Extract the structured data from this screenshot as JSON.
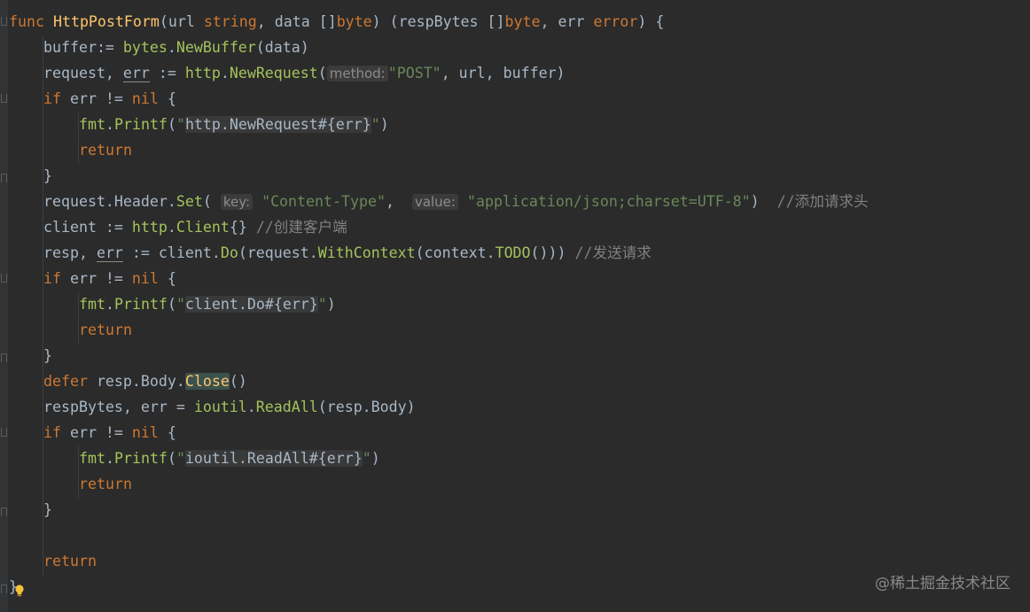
{
  "editor": {
    "line1": {
      "kw_func": "func",
      "fn_name": "HttpPostForm",
      "p1": "(url ",
      "t_string": "string",
      "p2": ", data []",
      "t_byte1": "byte",
      "p3": ") (respBytes []",
      "t_byte2": "byte",
      "p4": ", err ",
      "t_error": "error",
      "p5": ") {"
    },
    "line2": {
      "a": "buffer:= ",
      "pkg": "bytes",
      "dot": ".",
      "call": "NewBuffer",
      "b": "(data)"
    },
    "line3": {
      "a": "request, ",
      "err": "err",
      "b": " := ",
      "pkg": "http",
      "dot": ".",
      "call": "NewRequest",
      "c": "(",
      "hint": "method:",
      "str": "\"POST\"",
      "d": ", url, buffer)"
    },
    "line4": {
      "kw_if": "if",
      "a": " err != ",
      "kw_nil": "nil",
      "b": " {"
    },
    "line5": {
      "pkg": "fmt",
      "dot": ".",
      "call": "Printf",
      "a": "(",
      "q1": "\"",
      "tpl": "http.NewRequest#{err}",
      "q2": "\"",
      "b": ")"
    },
    "line6": {
      "kw_return": "return"
    },
    "line7": {
      "a": "}"
    },
    "line8": {
      "a": "request.Header.",
      "call": "Set",
      "b": "(",
      "hint_key": "key:",
      "str_key": "\"Content-Type\"",
      "c": ", ",
      "hint_value": "value:",
      "str_value": "\"application/json;charset=UTF-8\"",
      "d": ")",
      "comment": "//添加请求头"
    },
    "line9": {
      "a": "client := ",
      "pkg": "http",
      "dot": ".",
      "typ": "Client",
      "b": "{} ",
      "comment": "//创建客户端"
    },
    "line10": {
      "a": "resp, ",
      "err": "err",
      "b": " := client.",
      "call": "Do",
      "c": "(request.",
      "call2": "WithContext",
      "d": "(context.",
      "call3": "TODO",
      "e": "())) ",
      "comment": "//发送请求"
    },
    "line11": {
      "kw_if": "if",
      "a": " err != ",
      "kw_nil": "nil",
      "b": " {"
    },
    "line12": {
      "pkg": "fmt",
      "dot": ".",
      "call": "Printf",
      "a": "(",
      "q1": "\"",
      "tpl": "client.Do#{err}",
      "q2": "\"",
      "b": ")"
    },
    "line13": {
      "kw_return": "return"
    },
    "line14": {
      "a": "}"
    },
    "line15": {
      "kw_defer": "defer",
      "a": " resp.Body.",
      "call": "Close",
      "b": "()"
    },
    "line16": {
      "a": "respBytes, err = ",
      "pkg": "ioutil",
      "dot": ".",
      "call": "ReadAll",
      "b": "(resp.Body)"
    },
    "line17": {
      "kw_if": "if",
      "a": " err != ",
      "kw_nil": "nil",
      "b": " {"
    },
    "line18": {
      "pkg": "fmt",
      "dot": ".",
      "call": "Printf",
      "a": "(",
      "q1": "\"",
      "tpl": "ioutil.ReadAll#{err}",
      "q2": "\"",
      "b": ")"
    },
    "line19": {
      "kw_return": "return"
    },
    "line20": {
      "a": "}"
    },
    "line22": {
      "kw_return": "return"
    },
    "line23": {
      "a": "}"
    }
  },
  "watermark": "@稀土掘金技术社区",
  "colors": {
    "background": "#2b2b2b",
    "keyword": "#cc7832",
    "function": "#ffc66d",
    "string": "#6a8759",
    "comment": "#808080",
    "text": "#a9b7c6"
  },
  "icons": {
    "intention_bulb": "lightbulb-icon"
  }
}
